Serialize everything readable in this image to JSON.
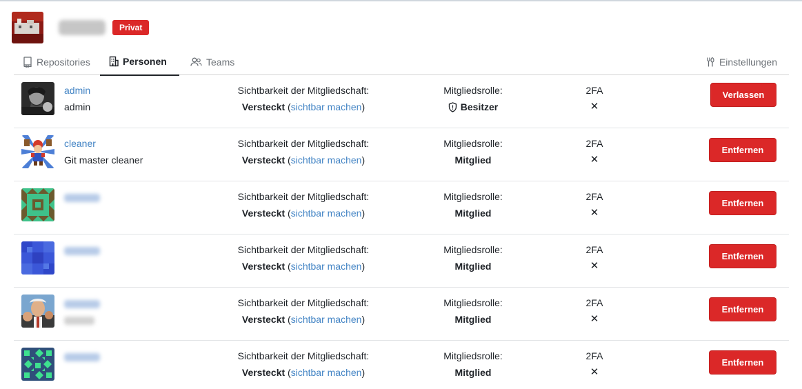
{
  "org": {
    "badge": "Privat"
  },
  "tabs": {
    "repositories": "Repositories",
    "people": "Personen",
    "teams": "Teams",
    "settings": "Einstellungen"
  },
  "columns": {
    "visibility_label": "Sichtbarkeit der Mitgliedschaft:",
    "role_label": "Mitgliedsrolle:",
    "twofa_label": "2FA"
  },
  "members": [
    {
      "username": "admin",
      "fullname": "admin",
      "visibility": "Versteckt",
      "visibility_open": "(",
      "visibility_action": "sichtbar machen",
      "visibility_close": ")",
      "role": "Besitzer",
      "twofa": "✕",
      "action": "Verlassen"
    },
    {
      "username": "cleaner",
      "fullname": "Git master cleaner",
      "visibility": "Versteckt",
      "visibility_open": "(",
      "visibility_action": "sichtbar machen",
      "visibility_close": ")",
      "role": "Mitglied",
      "twofa": "✕",
      "action": "Entfernen"
    },
    {
      "visibility": "Versteckt",
      "visibility_open": "(",
      "visibility_action": "sichtbar machen",
      "visibility_close": ")",
      "role": "Mitglied",
      "twofa": "✕",
      "action": "Entfernen"
    },
    {
      "visibility": "Versteckt",
      "visibility_open": "(",
      "visibility_action": "sichtbar machen",
      "visibility_close": ")",
      "role": "Mitglied",
      "twofa": "✕",
      "action": "Entfernen"
    },
    {
      "visibility": "Versteckt",
      "visibility_open": "(",
      "visibility_action": "sichtbar machen",
      "visibility_close": ")",
      "role": "Mitglied",
      "twofa": "✕",
      "action": "Entfernen"
    },
    {
      "visibility": "Versteckt",
      "visibility_open": "(",
      "visibility_action": "sichtbar machen",
      "visibility_close": ")",
      "role": "Mitglied",
      "twofa": "✕",
      "action": "Entfernen"
    }
  ],
  "colors": {
    "link": "#4183c4",
    "danger": "#db2828",
    "text": "#1f2328"
  }
}
